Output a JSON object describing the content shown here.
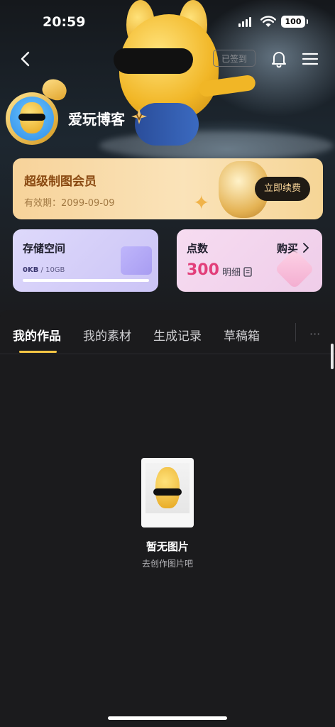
{
  "status_bar": {
    "time": "20:59",
    "battery": "100"
  },
  "nav": {
    "checkin_label": "已签到"
  },
  "profile": {
    "username": "爱玩博客"
  },
  "member": {
    "title": "超级制图会员",
    "expire_label": "有效期：",
    "expire_date": "2099-09-09",
    "renew_label": "立即续费"
  },
  "storage": {
    "title": "存储空间",
    "used": "0KB",
    "separator": " / ",
    "total": "10GB",
    "used_fraction": 0.0
  },
  "points": {
    "title": "点数",
    "buy_label": "购买",
    "value": "300",
    "detail_label": "明细"
  },
  "tabs": [
    {
      "label": "我的作品"
    },
    {
      "label": "我的素材"
    },
    {
      "label": "生成记录"
    },
    {
      "label": "草稿箱"
    }
  ],
  "more_label": "···",
  "empty_state": {
    "title": "暂无图片",
    "subtitle": "去创作图片吧"
  }
}
